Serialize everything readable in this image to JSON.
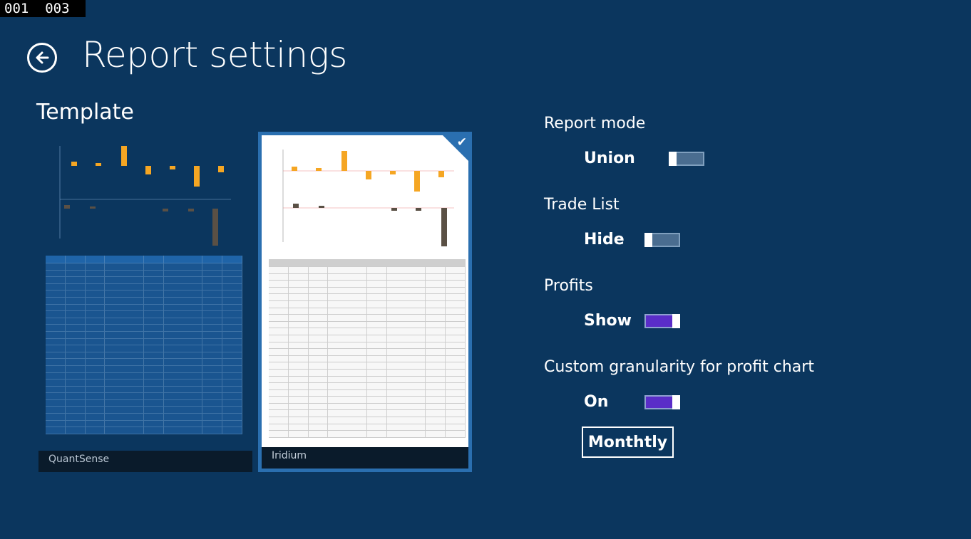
{
  "counter": "001  003",
  "header": {
    "title": "Report settings"
  },
  "template_section": {
    "title": "Template",
    "templates": [
      {
        "name": "QuantSense",
        "selected": false
      },
      {
        "name": "Iridium",
        "selected": true
      }
    ]
  },
  "settings": {
    "report_mode": {
      "label": "Report mode",
      "value": "Union",
      "on": false
    },
    "trade_list": {
      "label": "Trade List",
      "value": "Hide",
      "on": false
    },
    "profits": {
      "label": "Profits",
      "value": "Show",
      "on": true
    },
    "custom_granularity": {
      "label": "Custom granularity for profit chart",
      "value": "On",
      "on": true
    },
    "granularity_button": "Monthtly"
  },
  "colors": {
    "background": "#0b365e",
    "toggle_on": "#5a2dc8",
    "toggle_off": "#4a6d90",
    "bar_orange": "#f5a623",
    "bar_gray": "#5a5045"
  }
}
